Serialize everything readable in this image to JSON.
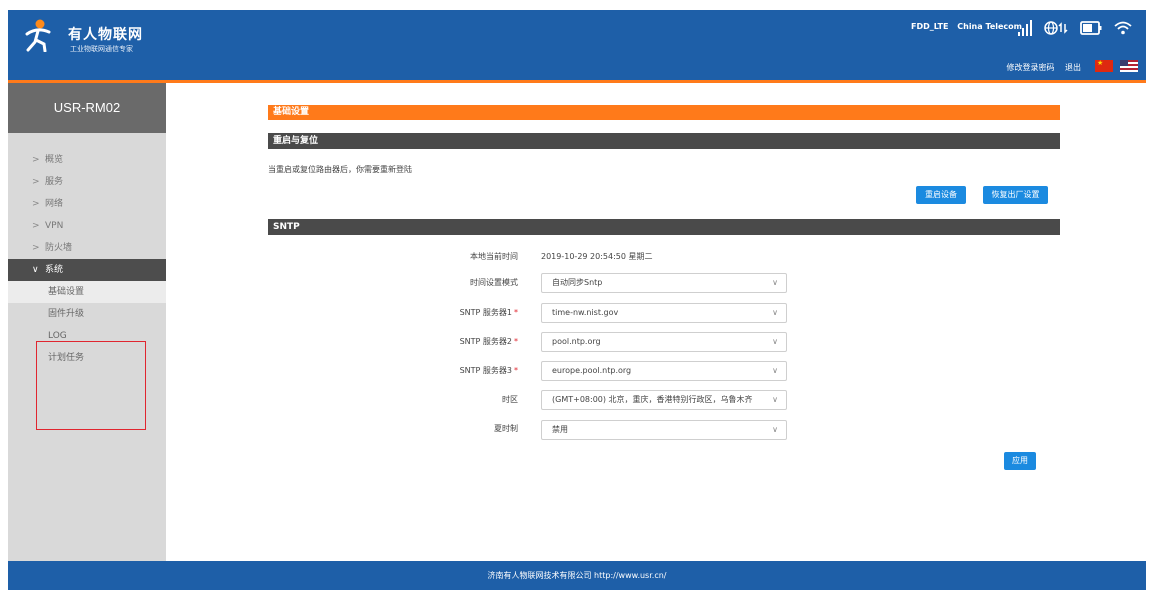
{
  "header": {
    "brand_name": "有人物联网",
    "brand_sub": "工业物联网通信专家",
    "network_type": "FDD_LTE",
    "carrier": "China Telecom",
    "links": {
      "change_password": "修改登录密码",
      "logout": "退出"
    },
    "icons": [
      "signal-icon",
      "network-data-icon",
      "battery-icon",
      "wifi-icon"
    ]
  },
  "sidebar": {
    "title": "USR-RM02",
    "items": [
      {
        "label": "概览"
      },
      {
        "label": "服务"
      },
      {
        "label": "网络"
      },
      {
        "label": "VPN"
      },
      {
        "label": "防火墙"
      },
      {
        "label": "系统",
        "expanded": true
      }
    ],
    "subitems": [
      {
        "label": "基础设置",
        "selected": true
      },
      {
        "label": "固件升级"
      },
      {
        "label": "LOG"
      },
      {
        "label": "计划任务"
      }
    ]
  },
  "main": {
    "section_title": "基础设置",
    "reboot": {
      "title": "重启与复位",
      "notice": "当重启或复位路由器后，你需要重新登陆",
      "reboot_button": "重启设备",
      "factory_button": "恢复出厂设置"
    },
    "sntp": {
      "title": "SNTP",
      "local_time_label": "本地当前时间",
      "local_time_value": "2019-10-29 20:54:50  星期二",
      "mode_label": "时间设置模式",
      "mode_value": "自动同步Sntp",
      "server1_label": "SNTP 服务器1",
      "server1_value": "time-nw.nist.gov",
      "server2_label": "SNTP 服务器2",
      "server2_value": "pool.ntp.org",
      "server3_label": "SNTP 服务器3",
      "server3_value": "europe.pool.ntp.org",
      "timezone_label": "时区",
      "timezone_value": "(GMT+08:00) 北京，重庆，香港特别行政区，乌鲁木齐",
      "dst_label": "夏时制",
      "dst_value": "禁用",
      "required_mark": "*",
      "apply_button": "应用"
    }
  },
  "footer": {
    "text": "济南有人物联网技术有限公司  http://www.usr.cn/"
  },
  "colors": {
    "header": "#1e5fa8",
    "accent": "#ff7a1a",
    "button": "#1b8ae0",
    "section": "#4a4a4a",
    "highlight": "#e0262f"
  }
}
